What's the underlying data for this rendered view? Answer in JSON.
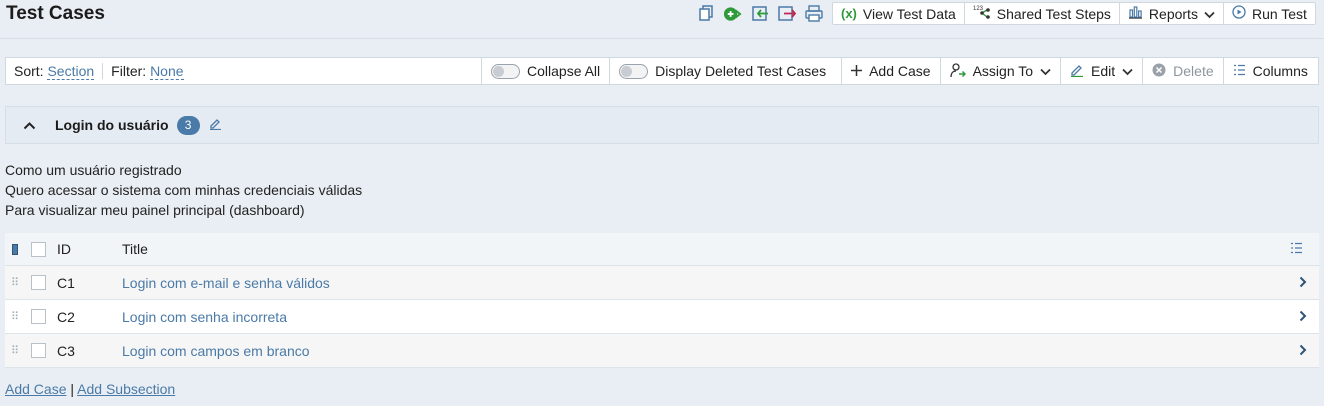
{
  "page": {
    "title": "Test Cases"
  },
  "header": {
    "icons": [
      "copy-icon",
      "add-run-icon",
      "import-icon",
      "export-icon",
      "print-icon"
    ],
    "buttons": {
      "view_test_data": "View Test Data",
      "shared_test_steps": "Shared Test Steps",
      "reports": "Reports",
      "run_test": "Run Test"
    }
  },
  "toolbar": {
    "sort_label": "Sort:",
    "sort_value": "Section",
    "filter_label": "Filter:",
    "filter_value": "None",
    "collapse_all": "Collapse All",
    "display_deleted": "Display Deleted Test Cases",
    "add_case": "Add Case",
    "assign_to": "Assign To",
    "edit": "Edit",
    "delete": "Delete",
    "columns": "Columns"
  },
  "section": {
    "title": "Login do usuário",
    "count": "3",
    "description": [
      "Como um usuário registrado",
      "Quero acessar o sistema com minhas credenciais válidas",
      "Para visualizar meu painel principal (dashboard)"
    ]
  },
  "table": {
    "columns": {
      "id": "ID",
      "title": "Title"
    },
    "rows": [
      {
        "id": "C1",
        "title": "Login com e-mail e senha válidos"
      },
      {
        "id": "C2",
        "title": "Login com senha incorreta"
      },
      {
        "id": "C3",
        "title": "Login com campos em branco"
      }
    ]
  },
  "footer": {
    "add_case": "Add Case",
    "separator": "|",
    "add_subsection": "Add Subsection"
  },
  "colors": {
    "accent": "#4a7aa7",
    "background": "#e9eef4",
    "green": "#2e9a3a",
    "red": "#c0264f"
  }
}
